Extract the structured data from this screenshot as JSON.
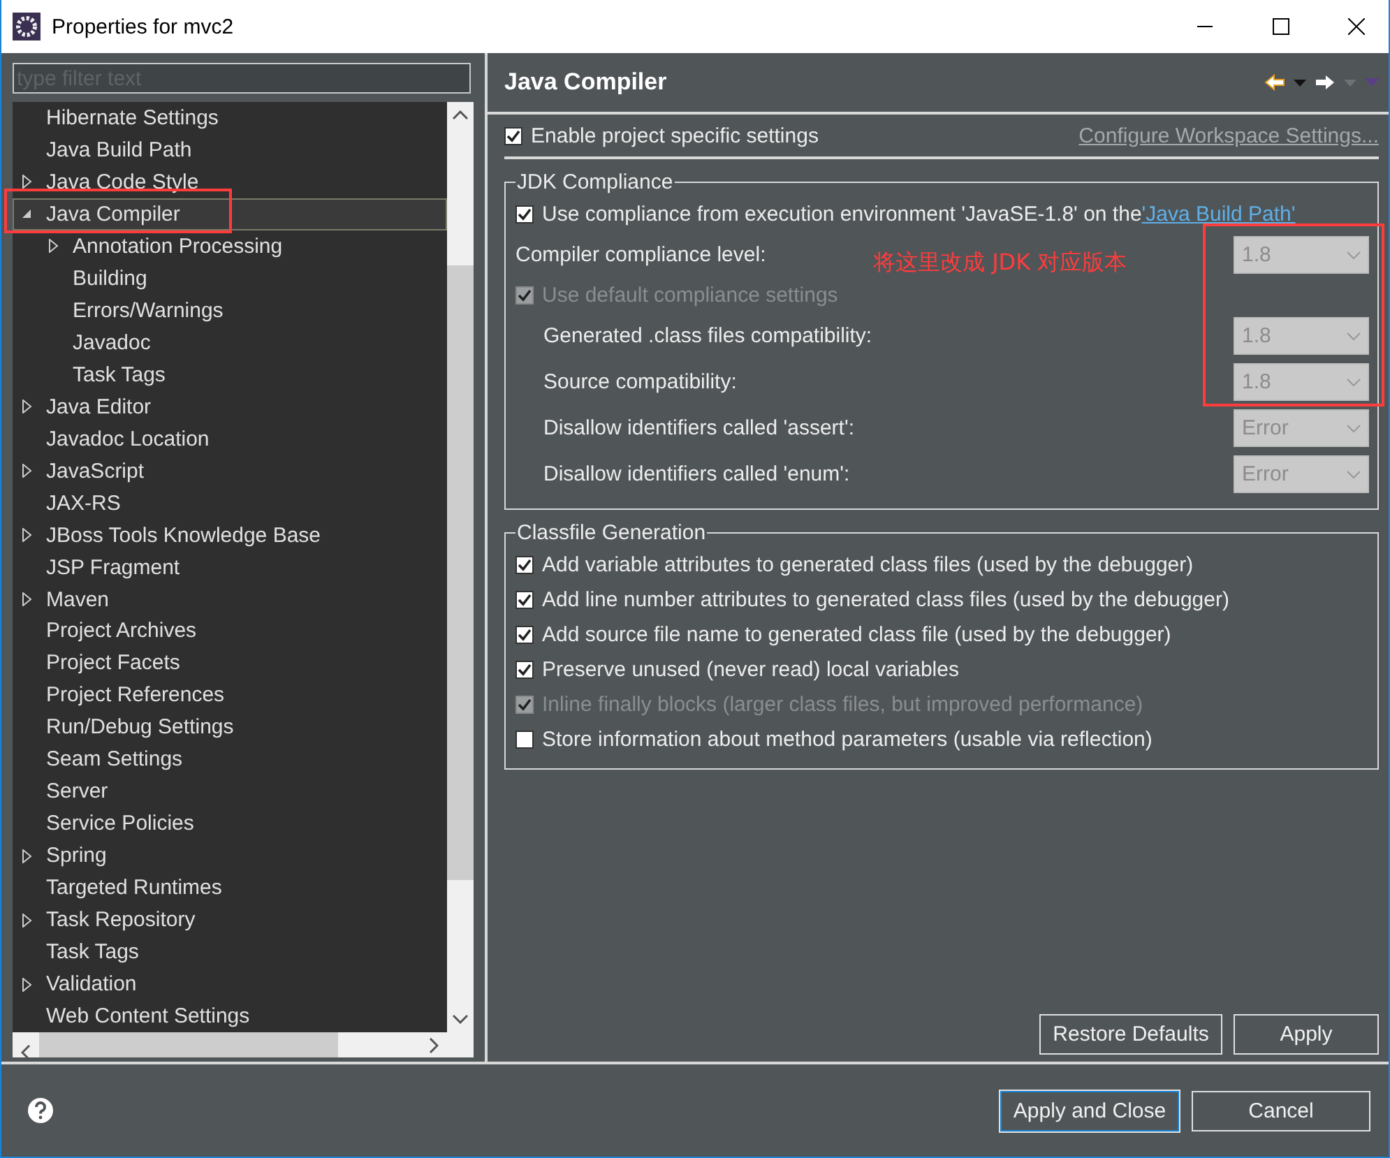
{
  "window": {
    "title": "Properties for mvc2"
  },
  "filter": {
    "placeholder": "type filter text"
  },
  "tree": [
    {
      "label": "Hibernate Settings",
      "selected": false
    },
    {
      "label": "Java Build Path",
      "selected": false
    },
    {
      "label": "Java Code Style",
      "selected": false,
      "expanded": false
    },
    {
      "label": "Java Compiler",
      "selected": true,
      "expanded": true,
      "outlined": true,
      "children": [
        {
          "label": "Annotation Processing",
          "selected": false,
          "expanded": false
        },
        {
          "label": "Building",
          "selected": false
        },
        {
          "label": "Errors/Warnings",
          "selected": false
        },
        {
          "label": "Javadoc",
          "selected": false
        },
        {
          "label": "Task Tags",
          "selected": false
        }
      ]
    },
    {
      "label": "Java Editor",
      "selected": false,
      "expanded": false
    },
    {
      "label": "Javadoc Location",
      "selected": false
    },
    {
      "label": "JavaScript",
      "selected": false,
      "expanded": false
    },
    {
      "label": "JAX-RS",
      "selected": false
    },
    {
      "label": "JBoss Tools Knowledge Base",
      "selected": false,
      "expanded": false
    },
    {
      "label": "JSP Fragment",
      "selected": false
    },
    {
      "label": "Maven",
      "selected": false,
      "expanded": false
    },
    {
      "label": "Project Archives",
      "selected": false
    },
    {
      "label": "Project Facets",
      "selected": false
    },
    {
      "label": "Project References",
      "selected": false
    },
    {
      "label": "Run/Debug Settings",
      "selected": false
    },
    {
      "label": "Seam Settings",
      "selected": false
    },
    {
      "label": "Server",
      "selected": false
    },
    {
      "label": "Service Policies",
      "selected": false
    },
    {
      "label": "Spring",
      "selected": false,
      "expanded": false
    },
    {
      "label": "Targeted Runtimes",
      "selected": false
    },
    {
      "label": "Task Repository",
      "selected": false,
      "expanded": false
    },
    {
      "label": "Task Tags",
      "selected": false
    },
    {
      "label": "Validation",
      "selected": false,
      "expanded": false
    },
    {
      "label": "Web Content Settings",
      "selected": false
    }
  ],
  "page": {
    "title": "Java Compiler",
    "enable": {
      "label": "Enable project specific settings",
      "checked": true
    },
    "workspace_link": {
      "label": "Configure Workspace Settings...",
      "disabled": true
    },
    "groups": [
      {
        "title": "JDK Compliance",
        "items": [
          {
            "kind": "checkbox",
            "label": "Use compliance from execution environment 'JavaSE-1.8' on the ",
            "link": "'Java Build Path'",
            "checked": true,
            "disabled": false,
            "indented": false
          },
          {
            "kind": "select",
            "label": "Compiler compliance level:",
            "value": "1.8",
            "disabled": true,
            "indented": false
          },
          {
            "kind": "checkbox",
            "label": "Use default compliance settings",
            "checked": true,
            "disabled": true,
            "indented": false
          },
          {
            "kind": "select",
            "label": "Generated .class files compatibility:",
            "value": "1.8",
            "disabled": true,
            "indented": true
          },
          {
            "kind": "select",
            "label": "Source compatibility:",
            "value": "1.8",
            "disabled": true,
            "indented": true
          },
          {
            "kind": "select",
            "label": "Disallow identifiers called 'assert':",
            "value": "Error",
            "disabled": true,
            "indented": true
          },
          {
            "kind": "select",
            "label": "Disallow identifiers called 'enum':",
            "value": "Error",
            "disabled": true,
            "indented": true
          }
        ]
      },
      {
        "title": "Classfile Generation",
        "items": [
          {
            "kind": "checkbox",
            "label": "Add variable attributes to generated class files (used by the debugger)",
            "checked": true,
            "disabled": false,
            "indented": false
          },
          {
            "kind": "checkbox",
            "label": "Add line number attributes to generated class files (used by the debugger)",
            "checked": true,
            "disabled": false,
            "indented": false
          },
          {
            "kind": "checkbox",
            "label": "Add source file name to generated class file (used by the debugger)",
            "checked": true,
            "disabled": false,
            "indented": false
          },
          {
            "kind": "checkbox",
            "label": "Preserve unused (never read) local variables",
            "checked": true,
            "disabled": false,
            "indented": false
          },
          {
            "kind": "checkbox",
            "label": "Inline finally blocks (larger class files, but improved performance)",
            "checked": true,
            "disabled": true,
            "indented": false
          },
          {
            "kind": "checkbox",
            "label": "Store information about method parameters (usable via reflection)",
            "checked": false,
            "disabled": false,
            "indented": false
          }
        ]
      }
    ],
    "buttons": [
      "Restore Defaults",
      "Apply"
    ]
  },
  "annotation": {
    "text": "将这里改成 JDK 对应版本",
    "color": "#ff3c3c"
  },
  "footer": {
    "buttons": [
      "Apply and Close",
      "Cancel"
    ]
  }
}
